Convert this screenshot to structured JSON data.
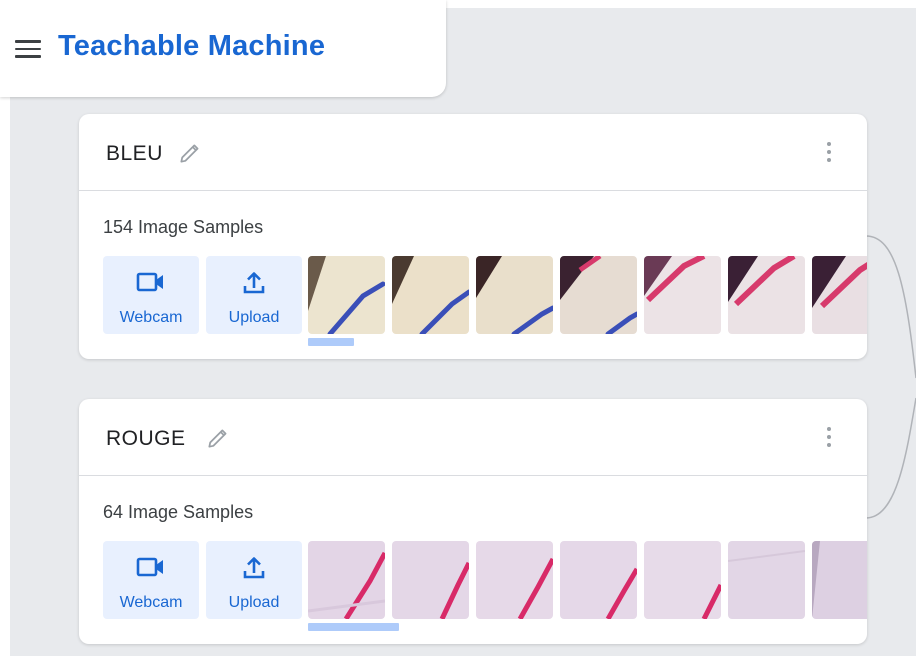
{
  "header": {
    "title": "Teachable Machine",
    "menu_icon": "hamburger-menu-icon"
  },
  "classes": [
    {
      "name": "BLEU",
      "sample_count": "154 Image Samples",
      "webcam_label": "Webcam",
      "upload_label": "Upload",
      "thumbnails": 7,
      "scroll_fraction": 0.09,
      "stroke_color": "#3a4fb8"
    },
    {
      "name": "ROUGE",
      "sample_count": "64 Image Samples",
      "webcam_label": "Webcam",
      "upload_label": "Upload",
      "thumbnails": 7,
      "scroll_fraction": 0.18,
      "stroke_color": "#e0306a"
    }
  ],
  "colors": {
    "brand": "#1967d2",
    "button_bg": "#e8f0fe",
    "canvas_bg": "#e8eaed",
    "scroll_thumb": "#aecbfa"
  }
}
